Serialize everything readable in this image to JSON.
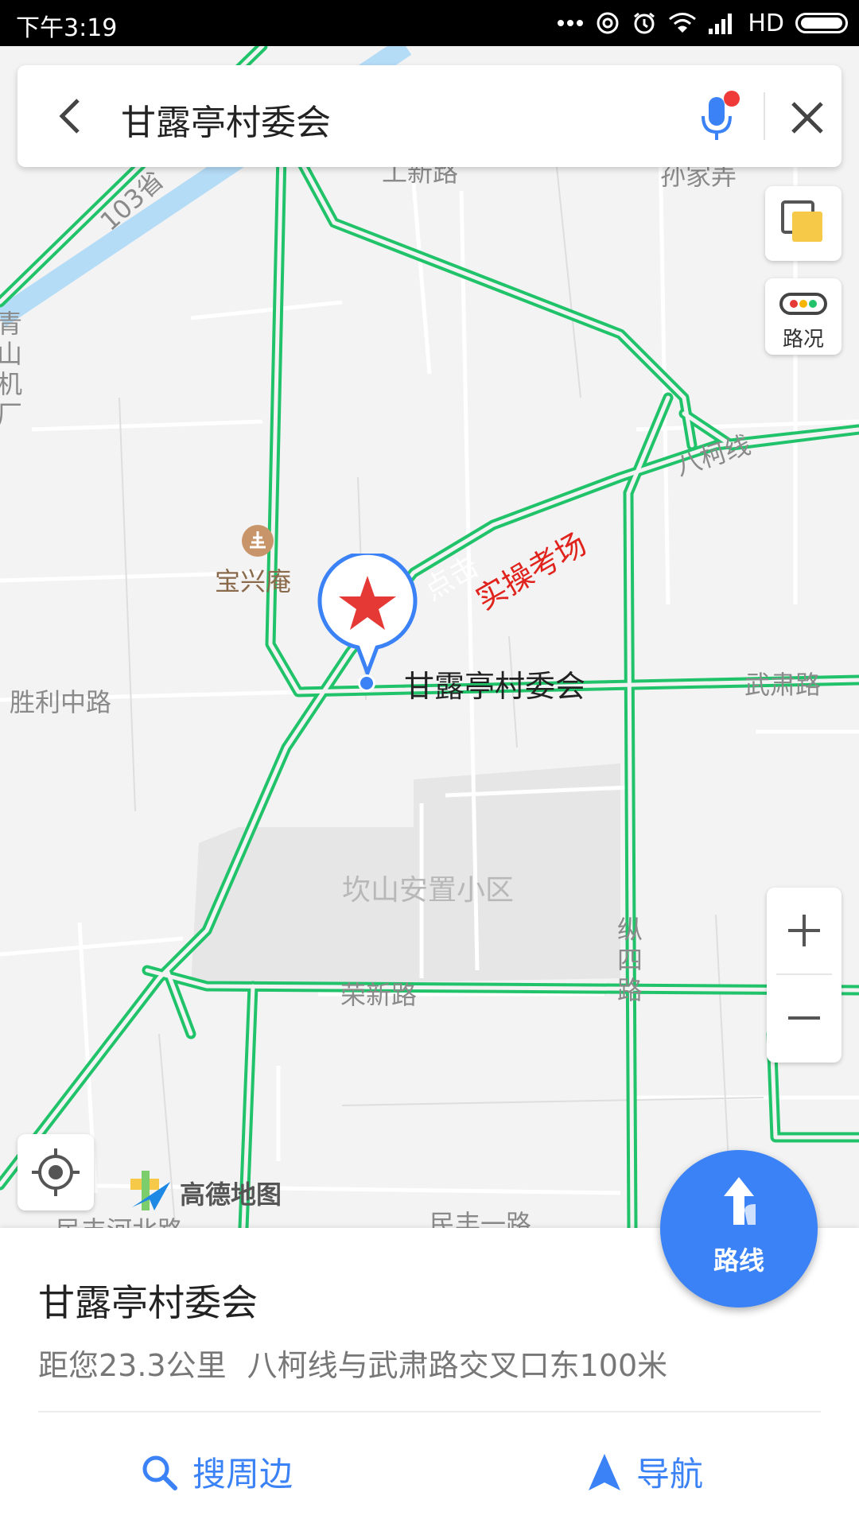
{
  "status_bar": {
    "time": "下午3:19",
    "network": "HD",
    "icons": [
      "more-dots-icon",
      "hotspot-icon",
      "alarm-icon",
      "wifi-icon",
      "signal-icon",
      "battery-icon"
    ]
  },
  "search": {
    "query": "甘露亭村委会",
    "icons": [
      "back-arrow-icon",
      "microphone-icon",
      "close-icon"
    ]
  },
  "map": {
    "marker_label": "甘露亭村委会",
    "watermark_text": "实操考场",
    "watermark_faded_text": "点击",
    "road_labels": {
      "bake_line": "八柯线",
      "wusu_road": "武肃路",
      "shengli_middle": "胜利中路",
      "rongxin_road": "荣新路",
      "zongsi_road": "纵四路",
      "minfeng_1": "民丰一路",
      "minfeng_river_north": "民丰河北路",
      "top_road": "工新路",
      "top_right": "孙家弄",
      "canal_label": "103省"
    },
    "area_labels": {
      "kanshan": "坎山安置小区",
      "left_edge": "青山机厂"
    },
    "poi": {
      "name": "宝兴庵",
      "icon": "temple-icon"
    },
    "colors": {
      "road": "#21c36a",
      "water": "#b5dcf7",
      "marker_red": "#e53935",
      "marker_blue": "#3b82f6"
    }
  },
  "controls": {
    "traffic_label": "路况",
    "zoom_in": "+",
    "zoom_out": "−",
    "brand": "高德地图",
    "route_label": "路线"
  },
  "place_card": {
    "title": "甘露亭村委会",
    "distance": "距您23.3公里",
    "address": "八柯线与武肃路交叉口东100米",
    "actions": {
      "nearby": "搜周边",
      "navigate": "导航"
    },
    "accent": "#3b82f6"
  }
}
